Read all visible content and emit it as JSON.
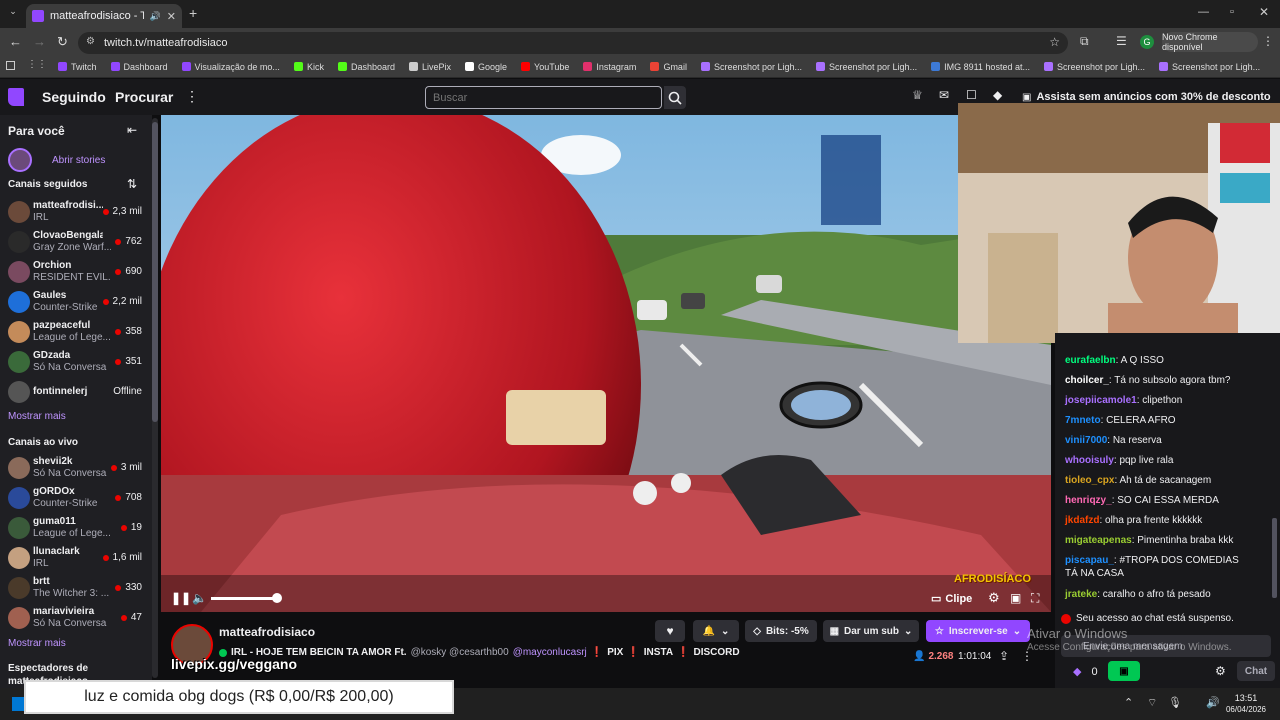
{
  "browser": {
    "tab_title": "matteafrodisiaco - Twitch",
    "url": "twitch.tv/matteafrodisiaco",
    "update_button": "Novo Chrome disponível",
    "profile_letter": "G",
    "bookmarks": [
      {
        "label": "Twitch",
        "color": "#9147ff"
      },
      {
        "label": "Dashboard",
        "color": "#9147ff"
      },
      {
        "label": "Visualização de mo...",
        "color": "#9147ff"
      },
      {
        "label": "Kick",
        "color": "#53fc18"
      },
      {
        "label": "Dashboard",
        "color": "#53fc18"
      },
      {
        "label": "LivePix",
        "color": "#cccccc"
      },
      {
        "label": "Google",
        "color": "#ffffff"
      },
      {
        "label": "YouTube",
        "color": "#ff0000"
      },
      {
        "label": "Instagram",
        "color": "#e1306c"
      },
      {
        "label": "Gmail",
        "color": "#ea4335"
      },
      {
        "label": "Screenshot por Ligh...",
        "color": "#a970ff"
      },
      {
        "label": "Screenshot por Ligh...",
        "color": "#a970ff"
      },
      {
        "label": "IMG 8911 hosted at...",
        "color": "#3d7ad6"
      },
      {
        "label": "Screenshot por Ligh...",
        "color": "#a970ff"
      },
      {
        "label": "Screenshot por Ligh...",
        "color": "#a970ff"
      }
    ]
  },
  "nav": {
    "following": "Seguindo",
    "browse": "Procurar",
    "search_placeholder": "Buscar",
    "promo": "Assista sem anúncios com 30% de desconto"
  },
  "sidebar": {
    "for_you": "Para você",
    "stories": "Abrir stories",
    "followed_header": "Canais seguidos",
    "followed": [
      {
        "name": "matteafrodisi...",
        "game": "IRL",
        "viewers": "2,3 mil",
        "color": "#6b4a3a"
      },
      {
        "name": "ClovaoBengala",
        "game": "Gray Zone Warf...",
        "viewers": "762",
        "color": "#2a2a2a"
      },
      {
        "name": "Orchion",
        "game": "RESIDENT EVIL...",
        "viewers": "690",
        "color": "#7a4a60"
      },
      {
        "name": "Gaules",
        "game": "Counter-Strike",
        "viewers": "2,2 mil",
        "color": "#1e6fd9"
      },
      {
        "name": "pazpeaceful",
        "game": "League of Lege...",
        "viewers": "358",
        "color": "#c48b5a"
      },
      {
        "name": "GDzada",
        "game": "Só Na Conversa",
        "viewers": "351",
        "color": "#3a6a3a"
      },
      {
        "name": "fontinnelerj",
        "game": "",
        "viewers": "Offline",
        "color": "#555555"
      }
    ],
    "show_more": "Mostrar mais",
    "live_header": "Canais ao vivo",
    "live": [
      {
        "name": "shevii2k",
        "game": "Só Na Conversa",
        "viewers": "3 mil",
        "color": "#8a6a5a"
      },
      {
        "name": "gORDOx",
        "game": "Counter-Strike",
        "viewers": "708",
        "color": "#2a4a9a"
      },
      {
        "name": "guma011",
        "game": "League of Lege...",
        "viewers": "19",
        "color": "#3a5a3a"
      },
      {
        "name": "llunaclark",
        "game": "IRL",
        "viewers": "1,6 mil",
        "color": "#c4a080"
      },
      {
        "name": "brtt",
        "game": "The Witcher 3: ...",
        "viewers": "330",
        "color": "#4a3a2a"
      },
      {
        "name": "mariavivieira",
        "game": "Só Na Conversa",
        "viewers": "47",
        "color": "#a06050"
      }
    ],
    "show_more_2": "Mostrar mais",
    "viewers_header": "Espectadores de",
    "viewers_sub": "matteafrodisiaco"
  },
  "player": {
    "clip_label": "Clipe",
    "overlay_text": "AFRODISÍACO"
  },
  "stream_info": {
    "channel": "matteafrodisiaco",
    "title": "IRL - HOJE TEM BEICIN TA AMOR Ft. @kosky @cesarthb00 @mayconlucasrj ❗ PIX ❗ INSTA ❗ DISCORD",
    "title_main": "IRL - HOJE TEM BEICIN TA AMOR Ft.",
    "title_mentions": "@kosky @cesarthb00",
    "title_highlight": "@mayconlucasrj",
    "title_links": [
      "PIX",
      "INSTA",
      "DISCORD"
    ],
    "livepix": "livepix.gg/veggano",
    "bits": "Bits: -5%",
    "gift_sub": "Dar um sub",
    "subscribe": "Inscrever-se",
    "viewer_count": "2.268",
    "uptime": "1:01:04"
  },
  "chat": {
    "messages": [
      {
        "user": "eurafaelbn",
        "color": "#00ff7f",
        "text": ": A Q ISSO"
      },
      {
        "user": "choilcer_",
        "color": "#ffffff",
        "text": ": Tá no subsolo agora tbm?"
      },
      {
        "user": "josepiicamole1",
        "color": "#a970ff",
        "text": ": clipethon"
      },
      {
        "user": "7mneto",
        "color": "#1e90ff",
        "text": ": CELERA AFRO"
      },
      {
        "user": "vinii7000",
        "color": "#1e90ff",
        "text": ": Na reserva"
      },
      {
        "user": "whooisuly",
        "color": "#a970ff",
        "text": ": pqp live rala"
      },
      {
        "user": "tioleo_cpx",
        "color": "#daa520",
        "text": ": Ah tá de sacanagem"
      },
      {
        "user": "henriqzy_",
        "color": "#ff69b4",
        "text": ": SO CAI ESSA MERDA"
      },
      {
        "user": "jkdafzd",
        "color": "#ff4500",
        "text": ": olha pra frente kkkkkk"
      },
      {
        "user": "migateapenas",
        "color": "#9acd32",
        "text": ": Pimentinha braba kkk"
      },
      {
        "user": "piscapau_",
        "color": "#1e90ff",
        "text": ": #TROPA DOS COMEDIAS"
      },
      {
        "user": "",
        "color": "#ffffff",
        "text": "TÁ NA CASA"
      },
      {
        "user": "jrateke",
        "color": "#9acd32",
        "text": ": caralho o afro tá pesado"
      }
    ],
    "suspended": "Seu acesso ao chat está suspenso.",
    "input_placeholder": "Envie uma mensagem",
    "points": "0",
    "chat_button": "Chat"
  },
  "windows": {
    "activate_title": "Ativar o Windows",
    "activate_sub": "Acesse Configurações para ativar o Windows.",
    "time": "13:51",
    "date": "06/04/2026"
  },
  "overlay_donation": "luz e comida obg dogs (R$ 0,00/R$ 200,00)"
}
